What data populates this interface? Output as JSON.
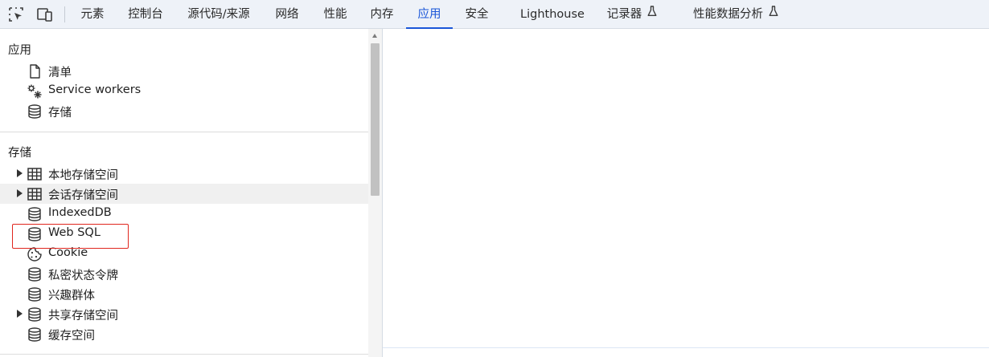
{
  "colors": {
    "accent": "#1a56d8",
    "toolbar_bg": "#eef2f8",
    "highlight": "#e0261e"
  },
  "toolbar": {
    "tabs": [
      {
        "label": "元素"
      },
      {
        "label": "控制台"
      },
      {
        "label": "源代码/来源"
      },
      {
        "label": "网络"
      },
      {
        "label": "性能"
      },
      {
        "label": "内存"
      },
      {
        "label": "应用"
      },
      {
        "label": "安全"
      },
      {
        "label": "Lighthouse"
      },
      {
        "label": "记录器"
      },
      {
        "label": "性能数据分析"
      }
    ],
    "active_tab": "应用",
    "icons": [
      "inspect-element-icon",
      "device-toolbar-icon",
      "flask-icon"
    ]
  },
  "sidebar": {
    "application": {
      "title": "应用",
      "items": [
        {
          "label": "清单",
          "icon": "file-icon"
        },
        {
          "label": "Service workers",
          "icon": "gears-icon"
        },
        {
          "label": "存储",
          "icon": "database-icon"
        }
      ]
    },
    "storage": {
      "title": "存储",
      "items": [
        {
          "label": "本地存储空间",
          "icon": "table-icon",
          "expandable": true
        },
        {
          "label": "会话存储空间",
          "icon": "table-icon",
          "expandable": true
        },
        {
          "label": "IndexedDB",
          "icon": "database-icon"
        },
        {
          "label": "Web SQL",
          "icon": "database-icon",
          "highlighted": true
        },
        {
          "label": "Cookie",
          "icon": "cookie-icon"
        },
        {
          "label": "私密状态令牌",
          "icon": "database-icon"
        },
        {
          "label": "兴趣群体",
          "icon": "database-icon"
        },
        {
          "label": "共享存储空间",
          "icon": "database-icon",
          "expandable": true
        },
        {
          "label": "缓存空间",
          "icon": "database-icon"
        }
      ]
    }
  }
}
